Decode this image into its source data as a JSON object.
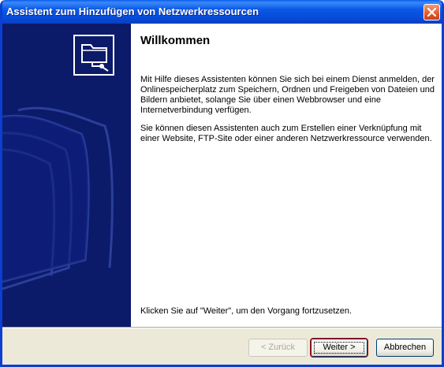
{
  "window": {
    "title": "Assistent zum Hinzufügen von Netzwerkressourcen"
  },
  "content": {
    "heading": "Willkommen",
    "paragraph1": "Mit Hilfe dieses Assistenten können Sie sich bei einem Dienst anmelden, der Onlinespeicherplatz zum Speichern, Ordnen und Freigeben von Dateien und Bildern anbietet, solange Sie über einen Webbrowser und eine Internetverbindung verfügen.",
    "paragraph2": "Sie können diesen Assistenten auch zum Erstellen einer Verknüpfung mit einer Website, FTP-Site oder einer anderen Netzwerkressource verwenden.",
    "footer_text": "Klicken Sie auf \"Weiter\", um den Vorgang fortzusetzen."
  },
  "buttons": {
    "back": "< Zurück",
    "next": "Weiter >",
    "cancel": "Abbrechen"
  },
  "colors": {
    "sidebar": "#0c1a6a",
    "titlebar": "#0a58e8",
    "default_button_outline": "#c00000"
  },
  "icons": {
    "wizard_logo": "network-folder-icon",
    "close": "close-icon"
  }
}
